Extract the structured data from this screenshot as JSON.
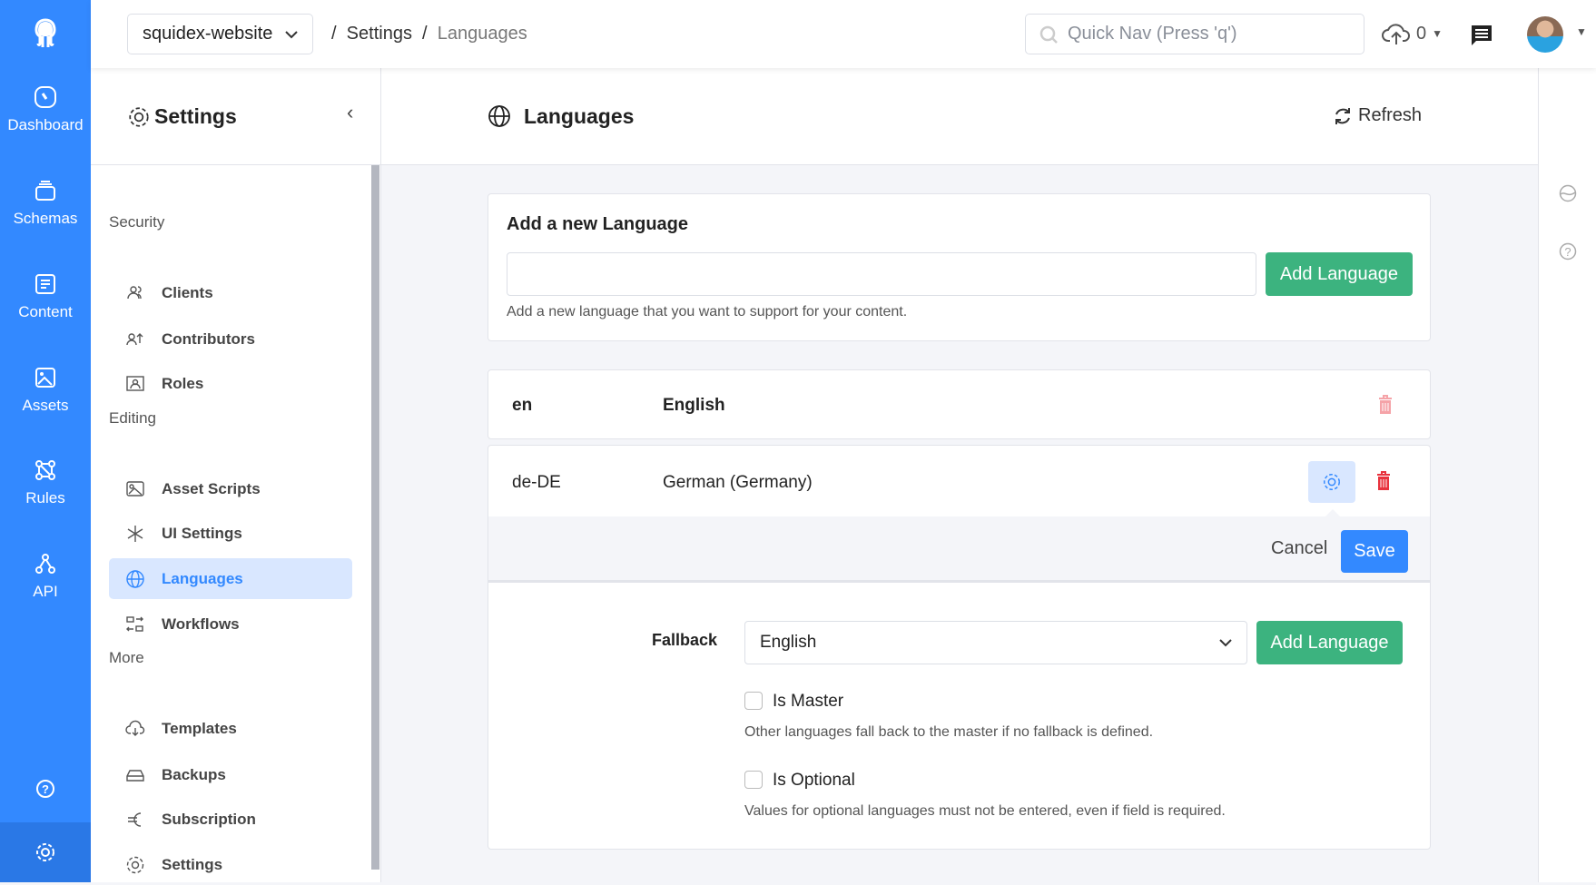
{
  "rail": {
    "items": [
      {
        "label": "Dashboard",
        "icon": "dashboard-icon"
      },
      {
        "label": "Schemas",
        "icon": "schemas-icon"
      },
      {
        "label": "Content",
        "icon": "content-icon"
      },
      {
        "label": "Assets",
        "icon": "assets-icon"
      },
      {
        "label": "Rules",
        "icon": "rules-icon"
      },
      {
        "label": "API",
        "icon": "api-icon"
      }
    ]
  },
  "topbar": {
    "app": "squidex-website",
    "breadcrumb": [
      "Settings",
      "Languages"
    ],
    "search_placeholder": "Quick Nav (Press 'q')",
    "uploads_count": "0"
  },
  "settings": {
    "title": "Settings",
    "sections": [
      {
        "label": "Security"
      },
      {
        "label": "Editing"
      },
      {
        "label": "More"
      }
    ],
    "items": [
      "Clients",
      "Contributors",
      "Roles",
      "Asset Scripts",
      "UI Settings",
      "Languages",
      "Workflows",
      "Templates",
      "Backups",
      "Subscription",
      "Settings"
    ],
    "active": "Languages"
  },
  "main": {
    "title": "Languages",
    "refresh": "Refresh",
    "add_card": {
      "title": "Add a new Language",
      "input_value": "",
      "button": "Add Language",
      "hint": "Add a new language that you want to support for your content."
    },
    "languages": [
      {
        "code": "en",
        "name": "English"
      },
      {
        "code": "de-DE",
        "name": "German (Germany)"
      }
    ],
    "editor": {
      "cancel": "Cancel",
      "save": "Save",
      "fallback_label": "Fallback",
      "fallback_value": "English",
      "add_button": "Add Language",
      "is_master": {
        "label": "Is Master",
        "checked": false,
        "hint": "Other languages fall back to the master if no fallback is defined."
      },
      "is_optional": {
        "label": "Is Optional",
        "checked": false,
        "hint": "Values for optional languages must not be entered, even if field is required."
      }
    }
  },
  "colors": {
    "primary": "#3389ff",
    "success": "#3cb37f",
    "danger": "#e8333e"
  }
}
